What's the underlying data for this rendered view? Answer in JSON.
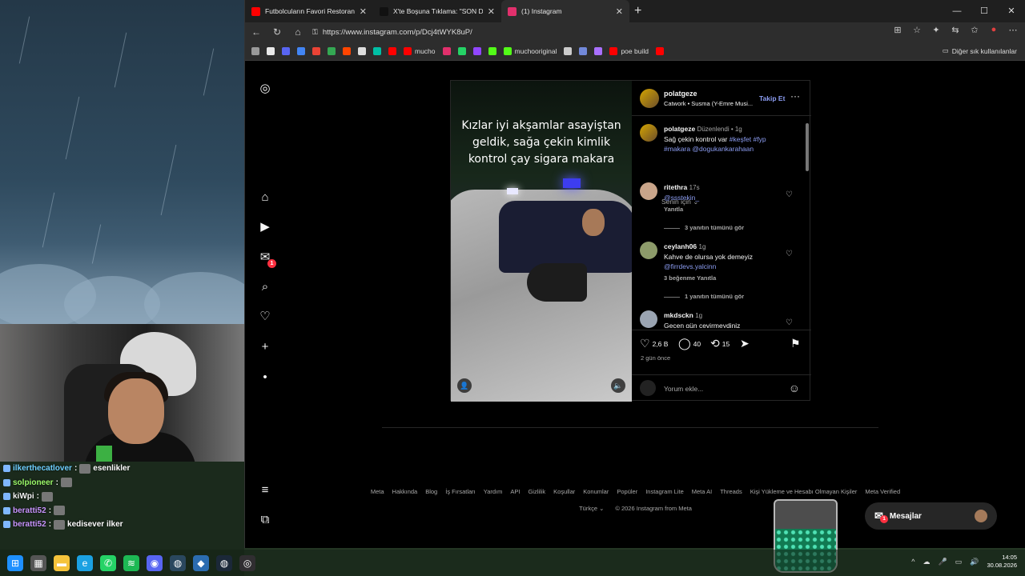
{
  "stream": {
    "chat": [
      {
        "user": "ilkerthecatlover",
        "sep": ":",
        "msg": "esenlikler",
        "color": "#6fd0ff"
      },
      {
        "user": "solpioneer",
        "sep": ":",
        "msg": "",
        "color": "#9dfc6b"
      },
      {
        "user": "kiWpi",
        "sep": ":",
        "msg": "",
        "color": "#f5f5f5"
      },
      {
        "user": "beratti52",
        "sep": ":",
        "msg": "",
        "color": "#c995ff"
      },
      {
        "user": "beratti52",
        "sep": ":",
        "msg": "kedisever ilker",
        "color": "#c995ff"
      }
    ]
  },
  "browser": {
    "tabs": [
      {
        "title": "Futbolcuların Favori Restoranlarını",
        "favcolor": "#ff0000",
        "active": false
      },
      {
        "title": "X'te Boşuna Tıklama: \"SON DAKİKA",
        "favcolor": "#111111",
        "active": false
      },
      {
        "title": "(1) Instagram",
        "favcolor": "#e1306c",
        "active": true
      }
    ],
    "new_tab": "+",
    "window_controls": {
      "min": "—",
      "max": "☐",
      "close": "✕"
    },
    "url": "https://www.instagram.com/p/Dcj4tWYK8uP/",
    "bookmarks": [
      {
        "label": "",
        "color": "#999999"
      },
      {
        "label": "",
        "color": "#e9e9e9"
      },
      {
        "label": "",
        "color": "#5865f2"
      },
      {
        "label": "",
        "color": "#4285f4"
      },
      {
        "label": "",
        "color": "#ea4335"
      },
      {
        "label": "",
        "color": "#34a853"
      },
      {
        "label": "",
        "color": "#ff4500"
      },
      {
        "label": "",
        "color": "#dddddd"
      },
      {
        "label": "",
        "color": "#00bfa5"
      },
      {
        "label": "",
        "color": "#ff0000"
      },
      {
        "label": "mucho",
        "color": "#ff0000"
      },
      {
        "label": "",
        "color": "#e1306c"
      },
      {
        "label": "",
        "color": "#25d366"
      },
      {
        "label": "",
        "color": "#9146ff"
      },
      {
        "label": "",
        "color": "#53fc18"
      },
      {
        "label": "muchooriginal",
        "color": "#53fc18"
      },
      {
        "label": "",
        "color": "#cccccc"
      },
      {
        "label": "",
        "color": "#7289da"
      },
      {
        "label": "",
        "color": "#a970ff"
      },
      {
        "label": "poe build",
        "color": "#ff0000"
      },
      {
        "label": "",
        "color": "#ff0000"
      }
    ],
    "other_bookmarks": "Diğer sık kullanılanlar"
  },
  "instagram": {
    "nav": [
      {
        "name": "instagram-logo-icon",
        "glyph": "◎"
      },
      {
        "name": "home-icon",
        "glyph": "⌂"
      },
      {
        "name": "reels-icon",
        "glyph": "▶"
      },
      {
        "name": "messages-icon",
        "glyph": "✉",
        "badge": "1"
      },
      {
        "name": "search-icon",
        "glyph": "⌕"
      },
      {
        "name": "notifications-icon",
        "glyph": "♡"
      },
      {
        "name": "create-icon",
        "glyph": "+"
      },
      {
        "name": "profile-icon",
        "glyph": "•"
      },
      {
        "name": "menu-icon",
        "glyph": "≡"
      },
      {
        "name": "also-from-meta-icon",
        "glyph": "⧉"
      }
    ],
    "post": {
      "caption_overlay": "Kızlar iyi akşamlar asayiştan geldik, sağa çekin kimlik kontrol çay sigara makara",
      "author": "polatgeze",
      "audio": "Catwork • Susma (Y-Emre Musi...",
      "follow": "Takip Et",
      "more": "···",
      "desc": {
        "user": "polatgeze",
        "edited": "Düzenlendi • 1g",
        "text": "Sağ çekin kontrol var ",
        "tags": "#keşfet #fyp #makara @dogukankarahaan"
      },
      "for_you": "Senin için ⌄",
      "comments": [
        {
          "user": "ritethra",
          "time": "17s",
          "text": "",
          "link": "@ssstekin_",
          "meta": "Yanıtla",
          "view_replies": "3 yanıtın tümünü gör"
        },
        {
          "user": "ceylanh06",
          "time": "1g",
          "text": "Kahve de olursa yok demeyiz",
          "link": "@firrdevs.yalcinn",
          "meta": "3 beğenme    Yanıtla",
          "view_replies": "1 yanıtın tümünü gör"
        },
        {
          "user": "mkdsckn",
          "time": "1g",
          "text": "Geçen gün çevirmeydiniz",
          "link": "",
          "meta": "",
          "view_replies": ""
        }
      ],
      "likes": "2,6 B",
      "comment_count": "40",
      "reposts": "15",
      "posted": "2 gün önce",
      "comment_placeholder": "Yorum ekle..."
    },
    "footer": {
      "links": [
        "Meta",
        "Hakkında",
        "Blog",
        "İş Fırsatları",
        "Yardım",
        "API",
        "Gizlilik",
        "Koşullar",
        "Konumlar",
        "Popüler",
        "Instagram Lite",
        "Meta AI",
        "Threads",
        "Kişi Yükleme ve Hesabı Olmayan Kişiler",
        "Meta Verified"
      ],
      "language": "Türkçe ⌄",
      "copyright": "© 2026 Instagram from Meta"
    },
    "messages_button": "Mesajlar",
    "messages_badge": "1"
  },
  "taskbar": {
    "apps": [
      {
        "name": "windows-start-icon",
        "color": "#1e90ff",
        "glyph": "⊞"
      },
      {
        "name": "task-view-icon",
        "color": "#555555",
        "glyph": "▦"
      },
      {
        "name": "file-explorer-icon",
        "color": "#f5c33b",
        "glyph": "▬"
      },
      {
        "name": "edge-icon",
        "color": "#1ba1e2",
        "glyph": "e"
      },
      {
        "name": "whatsapp-icon",
        "color": "#25d366",
        "glyph": "✆"
      },
      {
        "name": "spotify-icon",
        "color": "#1db954",
        "glyph": "≋"
      },
      {
        "name": "discord-icon",
        "color": "#5865f2",
        "glyph": "◉"
      },
      {
        "name": "steam-icon",
        "color": "#2a475e",
        "glyph": "◍"
      },
      {
        "name": "app-icon",
        "color": "#2b6cb0",
        "glyph": "◆"
      },
      {
        "name": "steam-alt-icon",
        "color": "#1b2838",
        "glyph": "◍"
      },
      {
        "name": "obs-icon",
        "color": "#302e31",
        "glyph": "◎"
      }
    ],
    "time": "14:05",
    "date": "30.08.2026"
  }
}
